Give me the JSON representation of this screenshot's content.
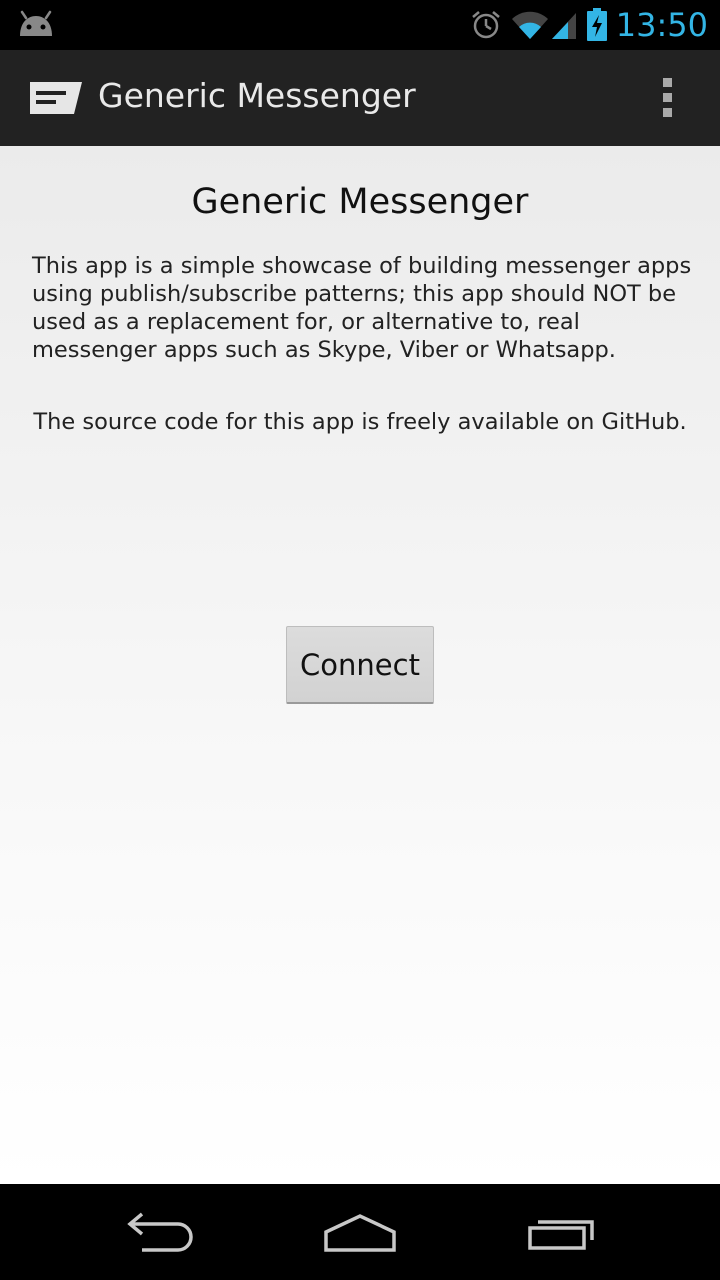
{
  "status_bar": {
    "time": "13:50",
    "icons": [
      "android-icon",
      "alarm-icon",
      "wifi-icon",
      "signal-icon",
      "battery-charging-icon"
    ],
    "time_color": "#33b5e5"
  },
  "action_bar": {
    "title": "Generic Messenger",
    "icon": "app-icon",
    "menu_icon": "overflow-menu-icon"
  },
  "main": {
    "heading": "Generic Messenger",
    "description": "This app is a simple showcase of building messenger apps using publish/subscribe patterns; this app should NOT be used as a replacement for, or alternative to, real messenger apps such as Skype, Viber or Whatsapp.",
    "source_note": "The source code for this app is freely available on GitHub.",
    "connect_label": "Connect"
  },
  "nav_bar": {
    "buttons": [
      "back-icon",
      "home-icon",
      "recents-icon"
    ]
  }
}
